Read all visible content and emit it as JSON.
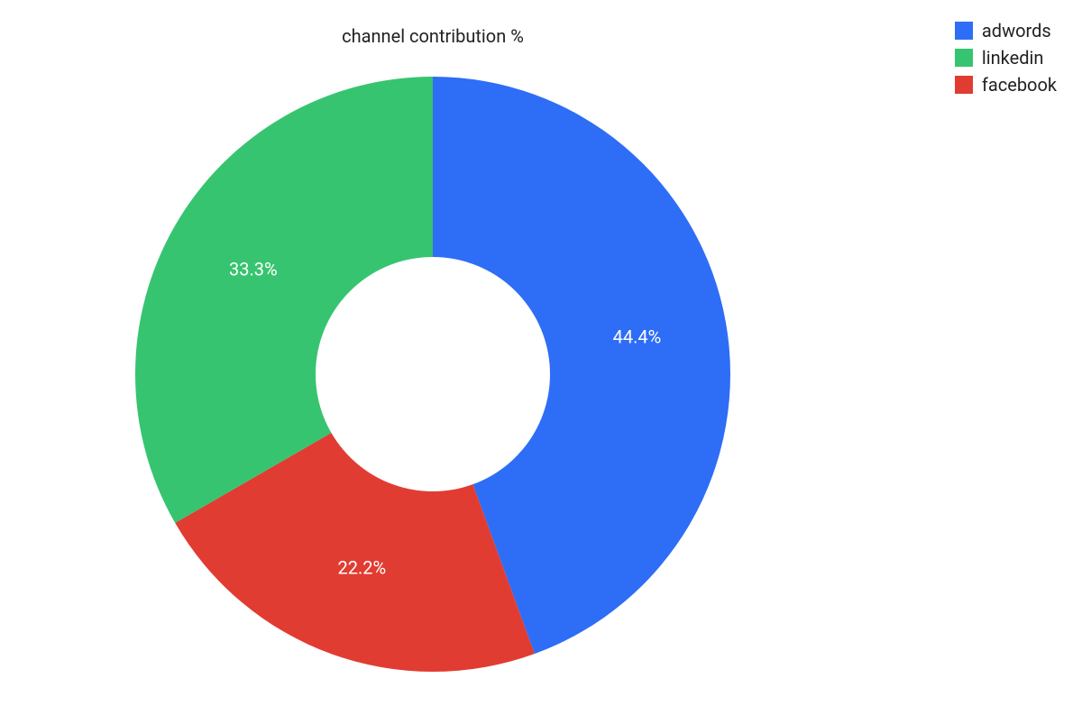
{
  "chart_data": {
    "type": "pie",
    "title": "channel contribution %",
    "series": [
      {
        "name": "adwords",
        "value": 44.4,
        "label": "44.4%",
        "color": "#2e6df6"
      },
      {
        "name": "linkedin",
        "value": 33.3,
        "label": "33.3%",
        "color": "#37c470"
      },
      {
        "name": "facebook",
        "value": 22.2,
        "label": "22.2%",
        "color": "#e13c32"
      }
    ],
    "donut": true
  },
  "legend": [
    {
      "label": "adwords",
      "color": "#2e6df6"
    },
    {
      "label": "linkedin",
      "color": "#37c470"
    },
    {
      "label": "facebook",
      "color": "#e13c32"
    }
  ]
}
